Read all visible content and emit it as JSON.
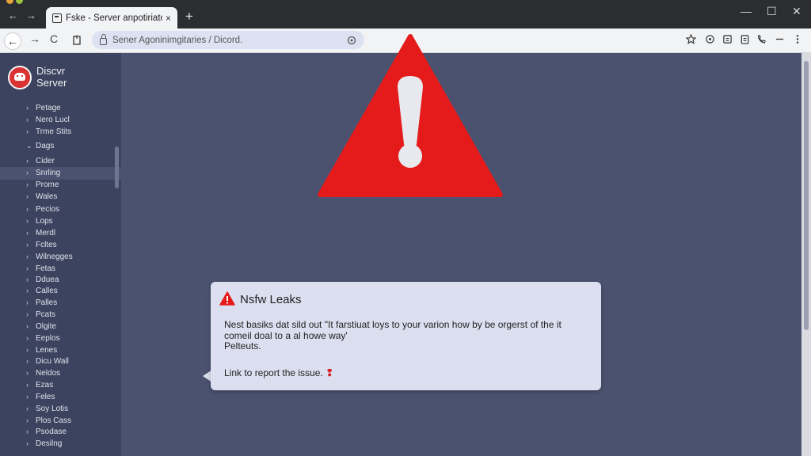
{
  "browser": {
    "tab_title": "Fske - Server anpotiriator",
    "tab_close": "×",
    "new_tab": "+",
    "back": "←",
    "forward": "→",
    "window_controls": {
      "minimize": "—",
      "maximize": "☐",
      "close": "✕"
    },
    "toolbar": {
      "back": "←",
      "forward": "→",
      "reload": "C",
      "url": "Sener Agoninimgitaries / Dicord."
    },
    "toolbar_icons": [
      "star-icon",
      "extension-icon",
      "collections-icon",
      "clipboard-icon",
      "phone-icon",
      "menu-icon"
    ]
  },
  "sidebar": {
    "server_name_line1": "Discvr",
    "server_name_line2": "Server",
    "items": [
      {
        "label": "Petage",
        "chevron": "›"
      },
      {
        "label": "Nero Lucl",
        "chevron": "›"
      },
      {
        "label": "Trme Stits",
        "chevron": "›"
      },
      {
        "label": "Dags",
        "chevron": "⌄"
      },
      {
        "label": "Cider",
        "chevron": "›"
      },
      {
        "label": "Snrling",
        "chevron": "›"
      },
      {
        "label": "Prome",
        "chevron": "›"
      },
      {
        "label": "Wales",
        "chevron": "›"
      },
      {
        "label": "Pecios",
        "chevron": "›"
      },
      {
        "label": "Lops",
        "chevron": "›"
      },
      {
        "label": "Merdl",
        "chevron": "›"
      },
      {
        "label": "Fcltes",
        "chevron": "›"
      },
      {
        "label": "Wilnegges",
        "chevron": "›"
      },
      {
        "label": "Fetas",
        "chevron": "›"
      },
      {
        "label": "Dduea",
        "chevron": "›"
      },
      {
        "label": "Calles",
        "chevron": "›"
      },
      {
        "label": "Palles",
        "chevron": "›"
      },
      {
        "label": "Pcats",
        "chevron": "›"
      },
      {
        "label": "Olgite",
        "chevron": "›"
      },
      {
        "label": "Eeplos",
        "chevron": "›"
      },
      {
        "label": "Lenes",
        "chevron": "›"
      },
      {
        "label": "Dicu Wall",
        "chevron": "›"
      },
      {
        "label": "Neldos",
        "chevron": "›"
      },
      {
        "label": "Ezas",
        "chevron": "›"
      },
      {
        "label": "Feles",
        "chevron": "›"
      },
      {
        "label": "Soy Lotis",
        "chevron": "›"
      },
      {
        "label": "Plos Cass",
        "chevron": "›"
      },
      {
        "label": "Psodase",
        "chevron": "›"
      },
      {
        "label": "Desilng",
        "chevron": "›"
      }
    ]
  },
  "dialog": {
    "title": "Nsfw Leaks",
    "body_line1": "Nest basiks dat sild out \"It farstiuat loys to your varion how by be orgerst of the it",
    "body_line2": "comeil doal to a al howe way'",
    "body_line3": "Pelteuts.",
    "link_text": "Link to report the issue.",
    "link_mark": "❢"
  },
  "colors": {
    "warning_red": "#e51b1b",
    "main_bg": "#4a5270",
    "sidebar_bg": "#3c435f",
    "dialog_bg": "#dcdff0"
  }
}
